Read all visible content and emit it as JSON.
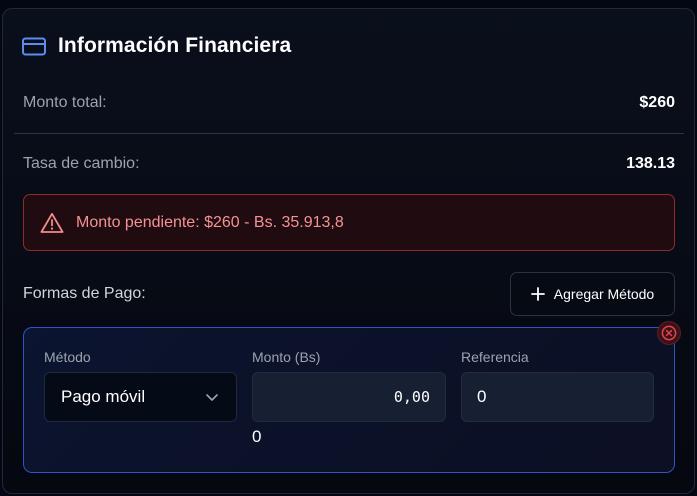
{
  "header": {
    "title": "Información Financiera",
    "icon": "credit-card-icon"
  },
  "summary": {
    "total_label": "Monto total:",
    "total_value": "$260",
    "rate_label": "Tasa de cambio:",
    "rate_value": "138.13"
  },
  "alert": {
    "icon": "warning-icon",
    "message": "Monto pendiente: $260 - Bs. 35.913,8"
  },
  "payments": {
    "section_label": "Formas de Pago:",
    "add_button_label": "Agregar Método",
    "items": [
      {
        "method_label": "Método",
        "method_value": "Pago móvil",
        "amount_label": "Monto (Bs)",
        "amount_value": "0,00",
        "amount_converted": "0",
        "reference_label": "Referencia",
        "reference_value": "0"
      }
    ]
  },
  "colors": {
    "accent_blue": "#2f54c9",
    "alert_red": "#f49393",
    "remove_red": "#e0454f"
  }
}
